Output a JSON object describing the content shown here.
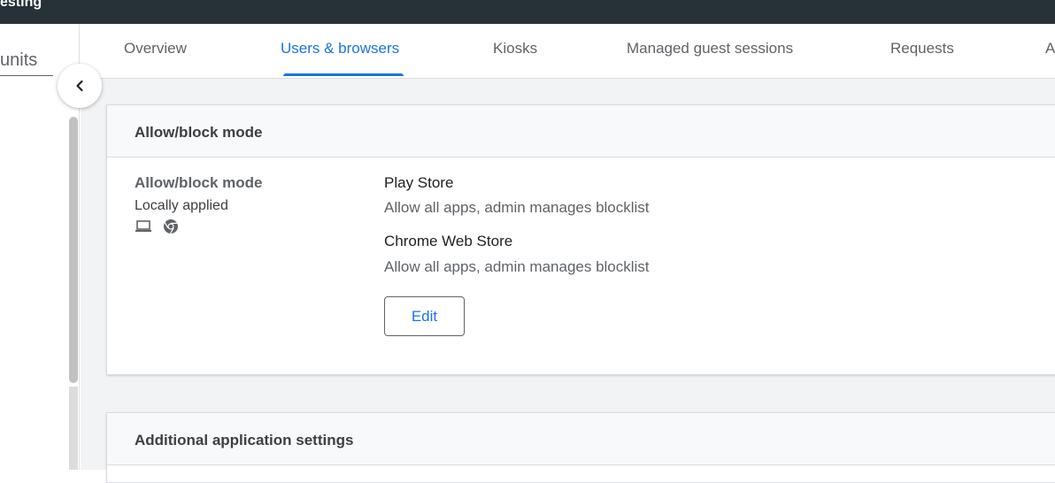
{
  "header": {
    "title": "esting"
  },
  "left_panel": {
    "units_label": "units"
  },
  "tabs": [
    {
      "label": "Overview",
      "active": false
    },
    {
      "label": "Users & browsers",
      "active": true
    },
    {
      "label": "Kiosks",
      "active": false
    },
    {
      "label": "Managed guest sessions",
      "active": false
    },
    {
      "label": "Requests",
      "active": false
    },
    {
      "label": "A",
      "active": false
    }
  ],
  "allow_block_card": {
    "title": "Allow/block mode",
    "setting_name": "Allow/block mode",
    "status": "Locally applied",
    "scope_icons": [
      "laptop-icon",
      "chrome-icon"
    ],
    "play_store_label": "Play Store",
    "play_store_value": "Allow all apps, admin manages blocklist",
    "chrome_store_label": "Chrome Web Store",
    "chrome_store_value": "Allow all apps, admin manages blocklist",
    "edit_label": "Edit"
  },
  "additional_card": {
    "title": "Additional application settings"
  },
  "colors": {
    "topbar": "#263238",
    "accent": "#1a73e8",
    "background": "#f1f3f4"
  }
}
